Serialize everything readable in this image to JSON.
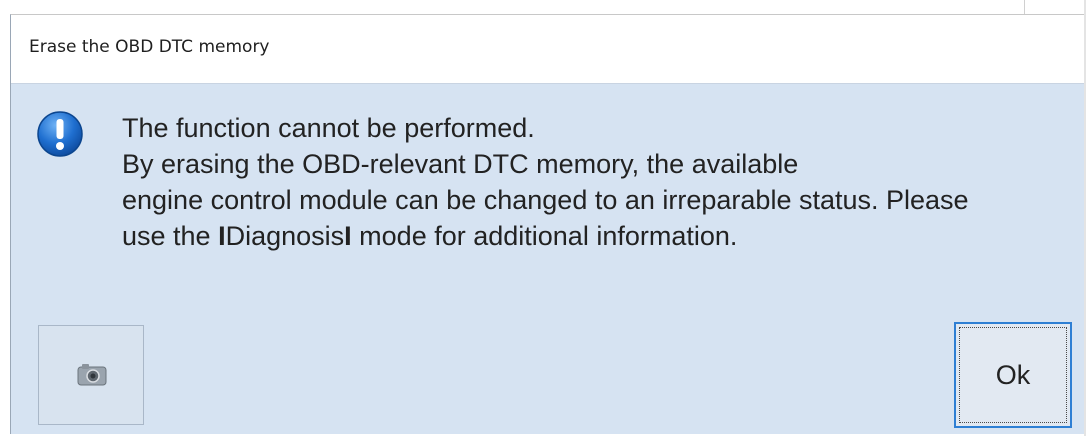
{
  "dialog": {
    "title": "Erase the OBD DTC memory",
    "icon": "info-exclamation-icon",
    "message_line1": "The function cannot be performed.",
    "message_line2": "By erasing the OBD-relevant DTC memory, the available",
    "message_line3": "engine control module can be changed to an irreparable status. Please",
    "message_line4_pre": "use the ",
    "message_line4_mark1": "I",
    "message_line4_word": "Diagnosis",
    "message_line4_mark2": "I",
    "message_line4_post": " mode for additional information.",
    "screenshot_button_icon": "camera-icon",
    "ok_label": "Ok"
  },
  "colors": {
    "dialog_bg": "#d6e3f2",
    "titlebar_bg": "#ffffff",
    "focus_border": "#2e7fd4",
    "icon_blue": "#1f6fd0"
  }
}
